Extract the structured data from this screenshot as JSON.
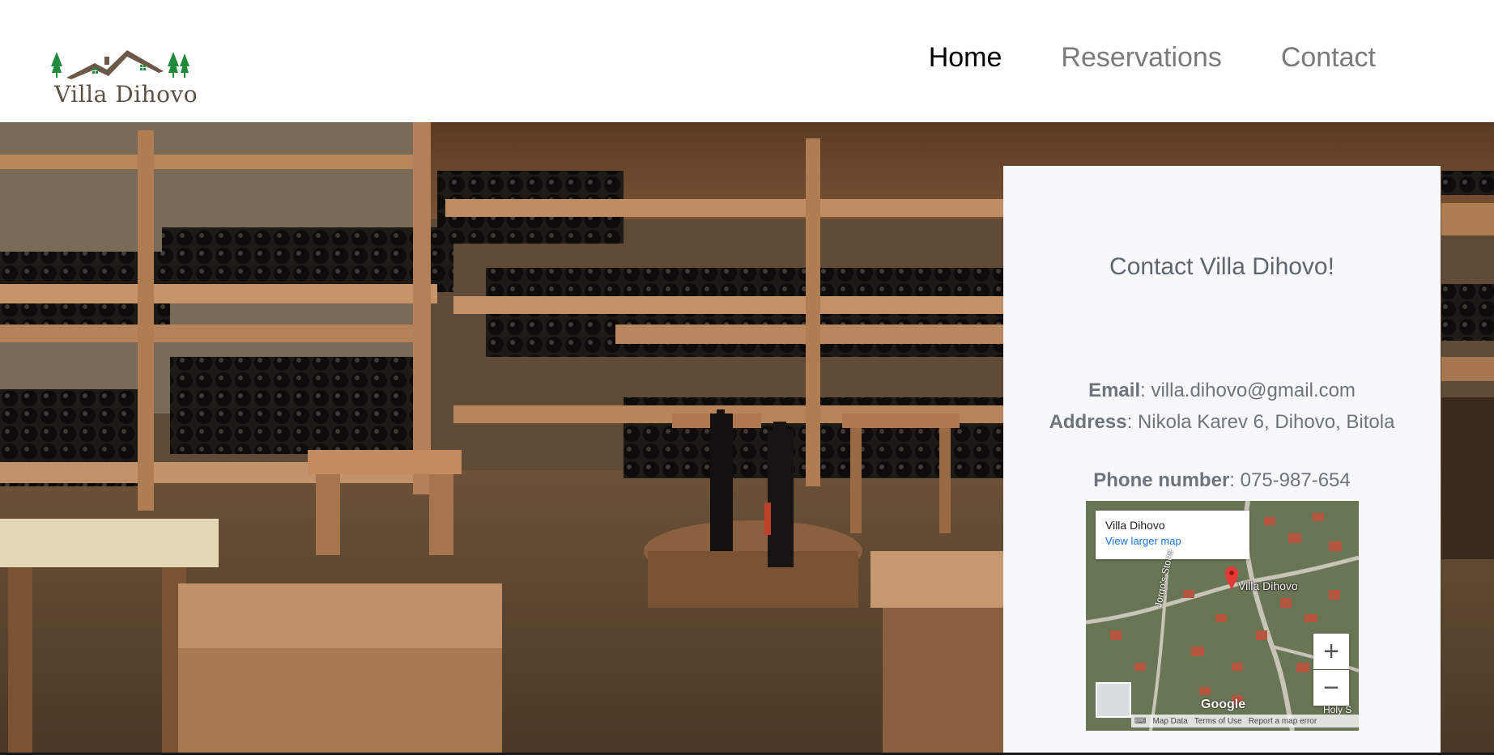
{
  "brand": {
    "logo_text": "Villa Dihovo"
  },
  "nav": {
    "items": [
      {
        "label": "Home",
        "active": true
      },
      {
        "label": "Reservations",
        "active": false
      },
      {
        "label": "Contact",
        "active": false
      }
    ]
  },
  "contact": {
    "title": "Contact Villa Dihovo!",
    "email_label": "Email",
    "email_value": ": villa.dihovo@gmail.com",
    "address_label": "Address",
    "address_value": ": Nikola Karev 6, Dihovo, Bitola",
    "phone_label": "Phone number",
    "phone_value": ": 075-987-654"
  },
  "map": {
    "place_name": "Villa Dihovo",
    "view_larger": "View larger map",
    "pin_label": "Villa Dihovo",
    "street_label": "Jorgo's Stone",
    "zoom_in": "+",
    "zoom_out": "−",
    "google": "Google",
    "corner_label": "Holy S",
    "footer": {
      "map_data": "Map Data",
      "terms": "Terms of Use",
      "report": "Report a map error"
    }
  },
  "colors": {
    "nav_active": "#000000",
    "nav_inactive": "#7a7a7a",
    "card_bg": "#f7f8fa",
    "text_muted": "#6c757d",
    "logo_green": "#1f8a3a",
    "logo_brown": "#6b5a4a"
  }
}
